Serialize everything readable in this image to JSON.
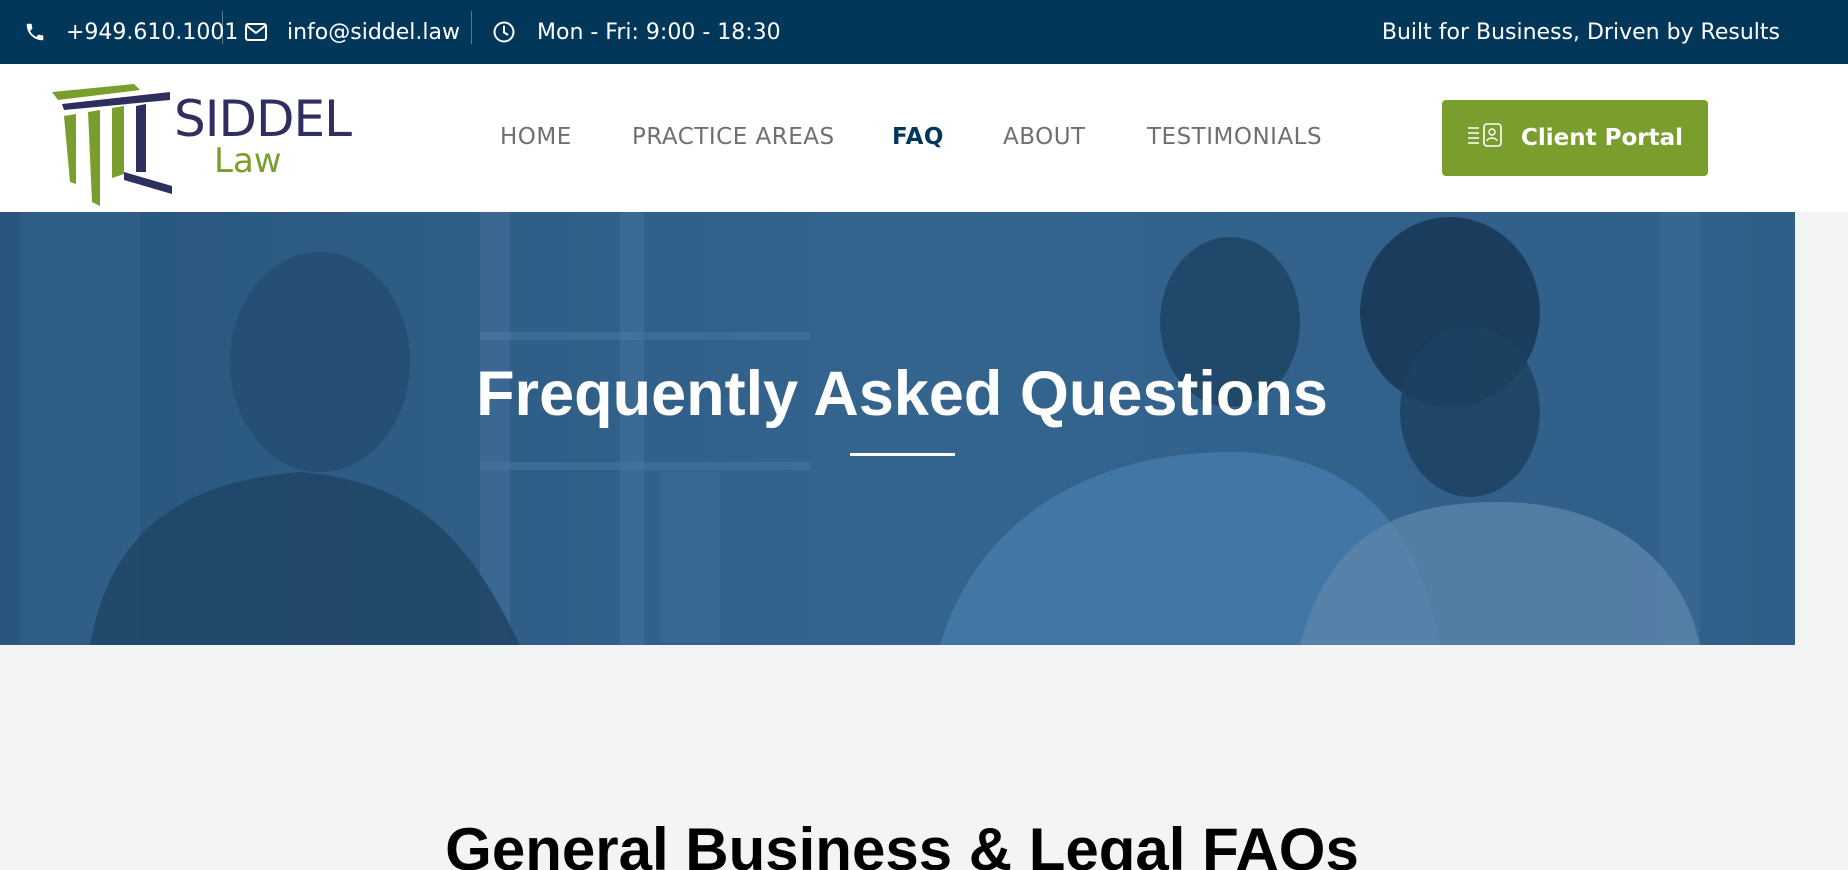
{
  "topbar": {
    "phone": "+949.610.1001",
    "email": "info@siddel.law",
    "hours": "Mon - Fri: 9:00 - 18:30",
    "tagline": "Built for Business, Driven by Results"
  },
  "logo": {
    "name": "SIDDEL",
    "sub": "Law"
  },
  "nav": {
    "home": "HOME",
    "practice_areas": "PRACTICE AREAS",
    "faq": "FAQ",
    "about": "ABOUT",
    "testimonials": "TESTIMONIALS"
  },
  "portal_button": {
    "label": "Client Portal",
    "icon": "portal-icon"
  },
  "hero": {
    "title": "Frequently Asked Questions"
  },
  "section": {
    "title": "General Business & Legal FAQs"
  },
  "colors": {
    "topbar": "#02375a",
    "brand_green": "#7a9e2e",
    "brand_navy": "#2e2e5f",
    "active_nav": "#02375a"
  }
}
